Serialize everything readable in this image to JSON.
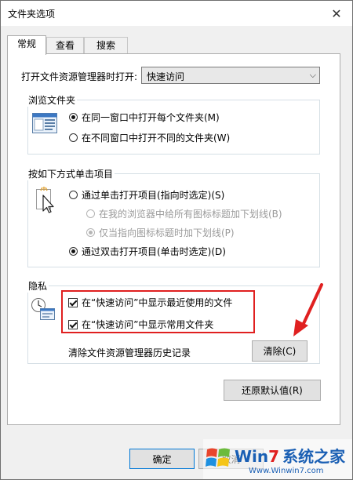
{
  "window": {
    "title": "文件夹选项"
  },
  "tabs": [
    {
      "label": "常规",
      "active": true
    },
    {
      "label": "查看",
      "active": false
    },
    {
      "label": "搜索",
      "active": false
    }
  ],
  "open_explorer": {
    "label": "打开文件资源管理器时打开:",
    "value": "快速访问"
  },
  "browse_folders": {
    "title": "浏览文件夹",
    "options": [
      {
        "label": "在同一窗口中打开每个文件夹(M)",
        "checked": true
      },
      {
        "label": "在不同窗口中打开不同的文件夹(W)",
        "checked": false
      }
    ]
  },
  "click_items": {
    "title": "按如下方式单击项目",
    "single": "通过单击打开项目(指向时选定)(S)",
    "sub_always": "在我的浏览器中给所有图标标题加下划线(B)",
    "sub_point": "仅当指向图标标题时加下划线(P)",
    "double": "通过双击打开项目(单击时选定)(D)"
  },
  "privacy": {
    "title": "隐私",
    "show_recent": "在“快速访问”中显示最近使用的文件",
    "show_frequent": "在“快速访问”中显示常用文件夹",
    "clear_label": "清除文件资源管理器历史记录",
    "clear_button": "清除(C)"
  },
  "restore_button": "还原默认值(R)",
  "footer": {
    "ok_button": "确定",
    "cancel_button": "取消"
  },
  "watermark": {
    "brand_prefix": "Win",
    "brand_num": "7",
    "brand_cn": "系统之家",
    "url": "Www.Winwin7.com"
  },
  "colors": {
    "accent": "#0078d7",
    "highlight": "#e02020",
    "watermark_blue": "#1a5fb4"
  }
}
